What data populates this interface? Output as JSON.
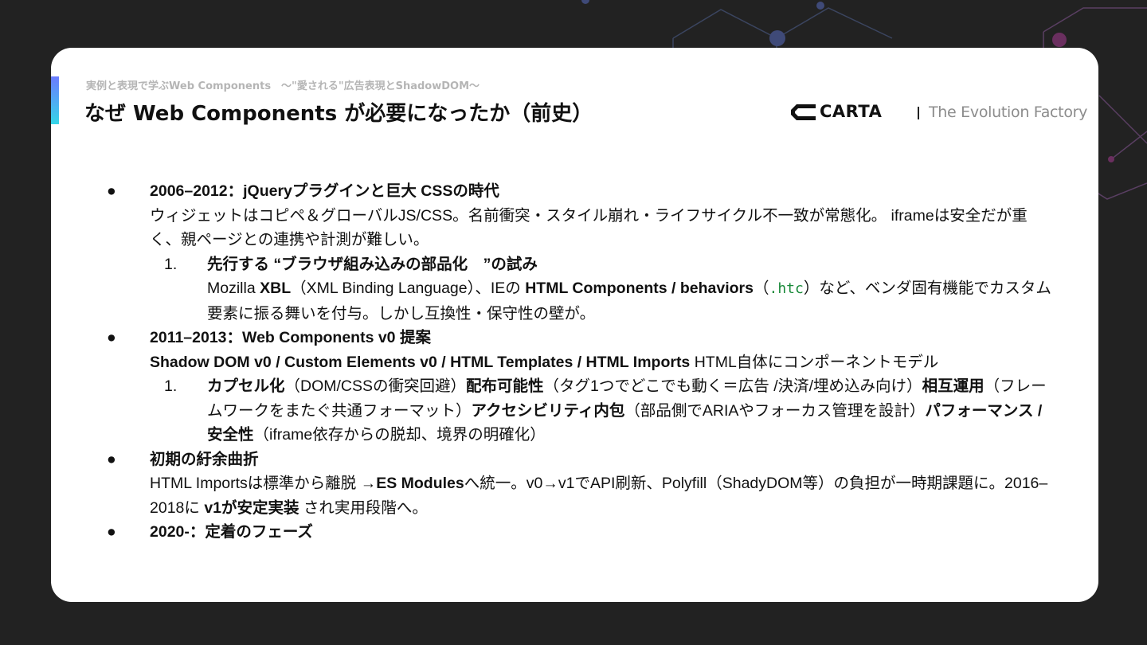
{
  "colors": {
    "background": "#222222",
    "slide": "#ffffff",
    "accent_top": "#6b7bff",
    "accent_bottom": "#35d6e8",
    "code": "#1a8a3a"
  },
  "header": {
    "subtitle": "実例と表現で学ぶWeb Components　～\"愛される\"広告表現とShadowDOM～",
    "title": "なぜ Web Components が必要になったか（前史）"
  },
  "logo": {
    "brand": "CARTA",
    "tagline": "The Evolution Factory",
    "mark_icon": "carta-logo-icon"
  },
  "bullet_glyph": "●",
  "sections": [
    {
      "heading": "2006–2012：jQueryプラグインと巨大 CSSの時代",
      "body": "ウィジェットはコピペ＆グローバルJS/CSS。名前衝突・スタイル崩れ・ライフサイクル不一致が常態化。 iframeは安全だが重く、親ページとの連携や計測が難しい。",
      "sub": {
        "num": "1.",
        "heading": "先行する “ブラウザ組み込みの部品化　”の試み",
        "t1": "Mozilla ",
        "b1": "XBL",
        "t2": "（XML Binding Language）、IEの ",
        "b2": "HTML Components / behaviors",
        "t3": "（",
        "code": ".htc",
        "t4": "）など、ベンダ固有機能でカスタム要素に振る舞いを付与。しかし互換性・保守性の壁が。"
      }
    },
    {
      "heading": "2011–2013：Web Components v0 提案",
      "b_body": "Shadow DOM v0 / Custom Elements v0 / HTML Templates / HTML Imports",
      "t_body": " HTML自体にコンポーネントモデル",
      "sub": {
        "num": "1.",
        "b1": "カプセル化",
        "t1": "（DOM/CSSの衝突回避）",
        "b2": "配布可能性",
        "t2": "（タグ1つでどこでも動く＝広告 /決済/埋め込み向け）",
        "b3": "相互運用",
        "t3": "（フレームワークをまたぐ共通フォーマット）",
        "b4": "アクセシビリティ内包",
        "t4": "（部品側でARIAやフォーカス管理を設計）",
        "b5": "パフォーマンス /安全性",
        "t5": "（iframe依存からの脱却、境界の明確化）"
      }
    },
    {
      "heading": "初期の紆余曲折",
      "t1": "HTML Importsは標準から離脱 →",
      "b1": "ES Modules",
      "t2": "へ統一。v0→v1でAPI刷新、Polyfill（ShadyDOM等）の負担が一時期課題に。2016–2018に ",
      "b2": "v1が安定実装",
      "t3": " され実用段階へ。"
    },
    {
      "heading": "2020-：定着のフェーズ"
    }
  ]
}
